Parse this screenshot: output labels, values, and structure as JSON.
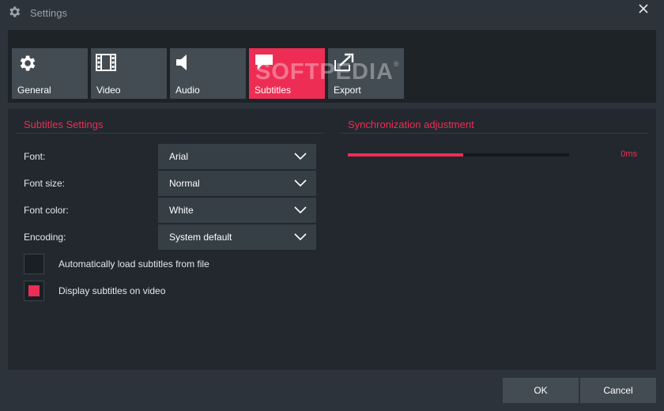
{
  "window": {
    "title": "Settings",
    "title_icon": "gear-icon",
    "close_icon": "close-icon"
  },
  "tabs": [
    {
      "label": "General",
      "icon": "gear-icon",
      "active": false
    },
    {
      "label": "Video",
      "icon": "film-icon",
      "active": false
    },
    {
      "label": "Audio",
      "icon": "speaker-icon",
      "active": false
    },
    {
      "label": "Subtitles",
      "icon": "speech-bubble-icon",
      "active": true
    },
    {
      "label": "Export",
      "icon": "export-icon",
      "active": false
    }
  ],
  "watermark": {
    "text": "SOFTPEDIA",
    "mark": "®"
  },
  "subtitles_settings": {
    "title": "Subtitles Settings",
    "fields": [
      {
        "label": "Font:",
        "value": "Arial"
      },
      {
        "label": "Font size:",
        "value": "Normal"
      },
      {
        "label": "Font color:",
        "value": "White"
      },
      {
        "label": "Encoding:",
        "value": "System default"
      }
    ],
    "checkboxes": [
      {
        "label": "Automatically load subtitles from file",
        "checked": false
      },
      {
        "label": "Display subtitles on video",
        "checked": true
      }
    ]
  },
  "sync": {
    "title": "Synchronization adjustment",
    "value_text": "0ms",
    "slider_fraction": 0.52
  },
  "footer": {
    "ok_label": "OK",
    "cancel_label": "Cancel"
  },
  "colors": {
    "accent": "#ee2d55",
    "background": "#2c333b",
    "panel": "#22282e",
    "tab": "#434b53"
  }
}
